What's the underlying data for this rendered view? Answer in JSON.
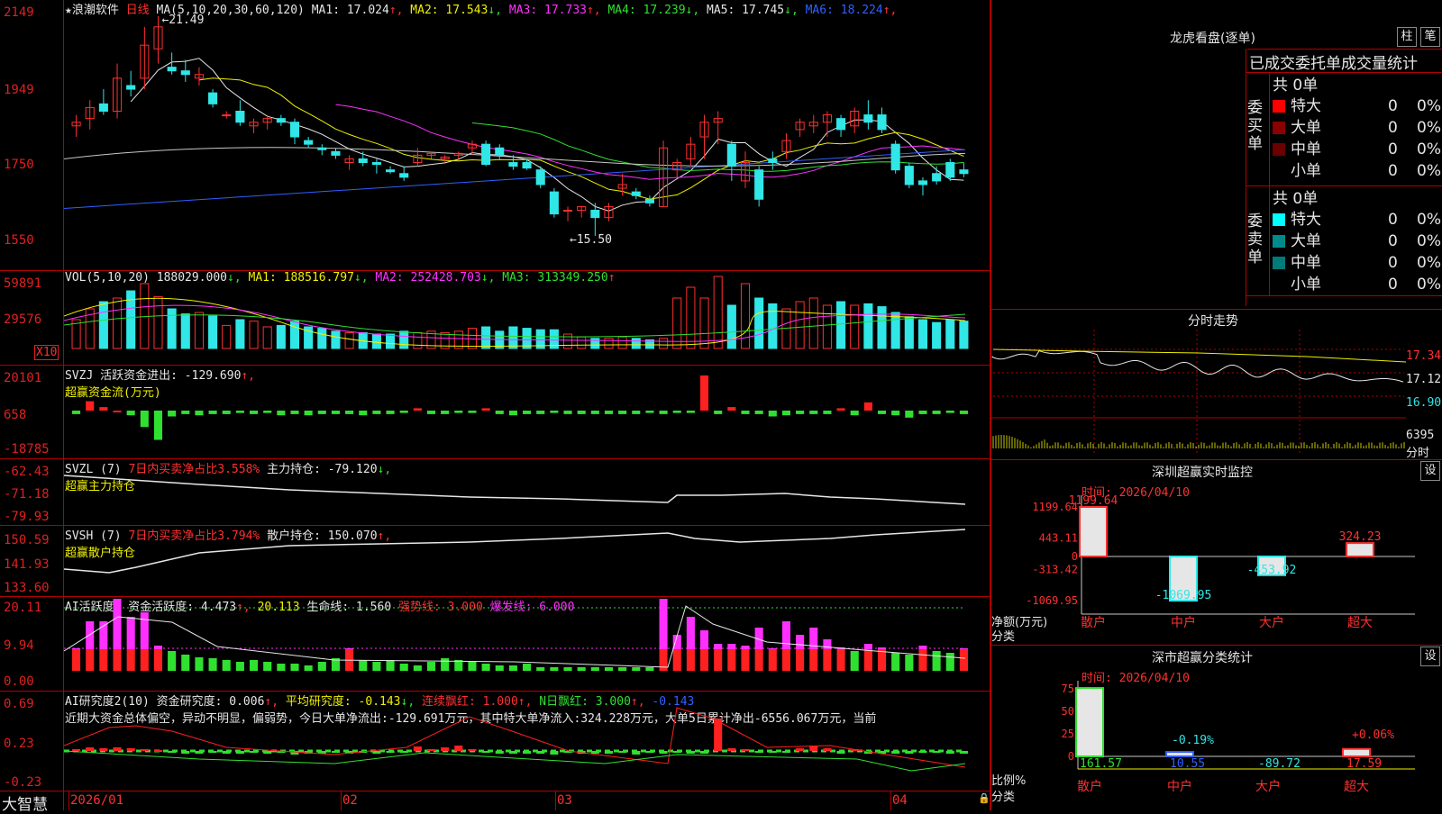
{
  "app": {
    "name": "浪潮软件",
    "period": "日线",
    "brand": "大智慧"
  },
  "main_chart": {
    "ma_params": "MA(5,10,20,30,60,120)",
    "ma": [
      {
        "label": "MA1: 17.024",
        "arrow": "↑",
        "color": "#e6e6e6"
      },
      {
        "label": "MA2: 17.543",
        "arrow": "↓",
        "color": "#f0f000"
      },
      {
        "label": "MA3: 17.733",
        "arrow": "↑",
        "color": "#ff30ff"
      },
      {
        "label": "MA4: 17.239",
        "arrow": "↓",
        "color": "#30e030"
      },
      {
        "label": "MA5: 17.745",
        "arrow": "↓",
        "color": "#e6e6e6"
      },
      {
        "label": "MA6: 18.224",
        "arrow": "↑",
        "color": "#3060ff"
      }
    ],
    "y_ticks": [
      "2149",
      "1949",
      "1750",
      "1550"
    ],
    "high_mark": "21.49",
    "low_mark": "15.50"
  },
  "vol": {
    "legend": "VOL(5,10,20) 188029.000",
    "ma1": "MA1: 188516.797",
    "ma2": "MA2: 252428.703",
    "ma3": "MA3: 313349.250",
    "y_ticks": [
      "59891",
      "29576"
    ],
    "unit": "X10"
  },
  "svzj": {
    "legend": "SVZJ  活跃资金进出: -129.690",
    "sub": "超赢资金流(万元)",
    "y_ticks": [
      "20101",
      "658",
      "-18785"
    ]
  },
  "svzl": {
    "legend": "SVZL (7)",
    "pct": "7日内买卖净占比3.558%",
    "hold": "主力持仓: -79.120",
    "sub": "超赢主力持仓",
    "y_ticks": [
      "-62.43",
      "-71.18",
      "-79.93"
    ]
  },
  "svsh": {
    "legend": "SVSH (7)",
    "pct": "7日内买卖净占比3.794%",
    "hold": "散户持仓: 150.070",
    "sub": "超赢散户持仓",
    "y_ticks": [
      "150.59",
      "141.93",
      "133.60"
    ]
  },
  "ai1": {
    "legend": "AI活跃度2 资金活跃度: 4.473",
    "v2": "20.113",
    "v3": "生命线: 1.560",
    "v4": "强势线: 3.000",
    "v5": "爆发线: 6.000",
    "y_ticks": [
      "20.11",
      "9.94",
      "0.00"
    ]
  },
  "ai2": {
    "legend": "AI研究度2(10) 资金研究度: 0.006",
    "v2": "平均研究度: -0.143",
    "v3": "连续飘红: 1.000",
    "v4": "N日飘红: 3.000",
    "v5": "-0.143",
    "comment": "近期大资金总体偏空，异动不明显，偏弱势，今日大单净流出:-129.691万元，其中特大单净流入:324.228万元，大单5日累计净出-6556.067万元，当前",
    "y_ticks": [
      "0.69",
      "0.23",
      "-0.23"
    ]
  },
  "x_axis": [
    "2026/01",
    "02",
    "03",
    "04"
  ],
  "right": {
    "lhb_title": "龙虎看盘(逐单)",
    "btn1": "柱",
    "btn2": "笔",
    "table_title": "已成交委托单成交量统计",
    "buy_side": "委买单",
    "sell_side": "委卖单",
    "buy_total": "共 0单",
    "sell_total": "共 0单",
    "buy_rows": [
      {
        "name": "特大",
        "n": "0",
        "p": "0%",
        "color": "#ff0000"
      },
      {
        "name": "大单",
        "n": "0",
        "p": "0%",
        "color": "#8b0000"
      },
      {
        "name": "中单",
        "n": "0",
        "p": "0%",
        "color": "#6b0000"
      },
      {
        "name": "小单",
        "n": "0",
        "p": "0%",
        "color": "#000000"
      }
    ],
    "sell_rows": [
      {
        "name": "特大",
        "n": "0",
        "p": "0%",
        "color": "#00ffff"
      },
      {
        "name": "大单",
        "n": "0",
        "p": "0%",
        "color": "#008b8b"
      },
      {
        "name": "中单",
        "n": "0",
        "p": "0%",
        "color": "#007a7a"
      },
      {
        "name": "小单",
        "n": "0",
        "p": "0%",
        "color": "#000000"
      }
    ],
    "fenshi_title": "分时走势",
    "fenshi_ticks": [
      "17.34",
      "17.12",
      "16.90"
    ],
    "fenshi_vol": "6395",
    "fenshi_lbl": "分时",
    "monitor_title": "深圳超赢实时监控",
    "set": "设",
    "monitor_time": "时间: 2026/04/10",
    "monitor_ticks": [
      "1199.64",
      "443.11",
      "0",
      "-313.42",
      "-1069.95"
    ],
    "monitor_values": [
      "1199.64",
      "-1069.95",
      "-453.92",
      "324.23"
    ],
    "monitor_ylabel": "净额(万元)",
    "monitor_xlabel": "分类",
    "cats": [
      "散户",
      "中户",
      "大户",
      "超大"
    ],
    "stat_title": "深市超赢分类统计",
    "stat_time": "时间: 2026/04/10",
    "stat_ticks": [
      "75",
      "50",
      "25",
      "0"
    ],
    "stat_pct": [
      "-0.19%",
      "+0.06%"
    ],
    "stat_values": [
      "161.57",
      "10.55",
      "-89.72",
      "17.59"
    ],
    "stat_ylabel": "比例%",
    "stat_xlabel": "分类"
  },
  "chart_data": {
    "type": "candlestick",
    "ohlc": [
      [
        18.5,
        18.8,
        18.2,
        18.6
      ],
      [
        18.7,
        19.2,
        18.4,
        19.0
      ],
      [
        19.1,
        19.5,
        18.8,
        18.9
      ],
      [
        18.9,
        20.2,
        18.7,
        19.8
      ],
      [
        19.6,
        20.0,
        19.3,
        19.5
      ],
      [
        19.8,
        21.2,
        19.5,
        20.7
      ],
      [
        20.6,
        21.49,
        20.2,
        21.2
      ],
      [
        20.1,
        20.5,
        19.9,
        20.0
      ],
      [
        20.0,
        20.3,
        19.7,
        19.9
      ],
      [
        19.8,
        20.1,
        19.6,
        19.9
      ],
      [
        19.4,
        19.5,
        19.0,
        19.1
      ],
      [
        18.8,
        18.9,
        18.7,
        18.8
      ],
      [
        18.9,
        19.2,
        18.5,
        18.6
      ],
      [
        18.5,
        18.7,
        18.3,
        18.6
      ],
      [
        18.6,
        18.8,
        18.4,
        18.7
      ],
      [
        18.7,
        18.8,
        18.5,
        18.6
      ],
      [
        18.6,
        18.7,
        18.0,
        18.2
      ],
      [
        18.1,
        18.2,
        17.9,
        18.0
      ],
      [
        17.9,
        18.0,
        17.7,
        17.85
      ],
      [
        17.8,
        17.9,
        17.6,
        17.7
      ],
      [
        17.5,
        17.7,
        17.3,
        17.6
      ],
      [
        17.6,
        17.8,
        17.4,
        17.5
      ],
      [
        17.5,
        17.6,
        17.2,
        17.45
      ],
      [
        17.3,
        17.4,
        17.2,
        17.25
      ],
      [
        17.2,
        17.4,
        17.0,
        17.1
      ],
      [
        17.5,
        17.9,
        17.4,
        17.7
      ],
      [
        17.7,
        17.8,
        17.6,
        17.75
      ],
      [
        17.6,
        17.7,
        17.5,
        17.65
      ],
      [
        17.7,
        17.8,
        17.6,
        17.75
      ],
      [
        17.9,
        18.1,
        17.7,
        18.0
      ],
      [
        18.0,
        18.1,
        17.4,
        17.45
      ],
      [
        17.9,
        18.0,
        17.6,
        17.7
      ],
      [
        17.5,
        17.7,
        17.3,
        17.4
      ],
      [
        17.5,
        17.6,
        17.3,
        17.35
      ],
      [
        17.3,
        17.4,
        16.8,
        16.9
      ],
      [
        16.7,
        16.8,
        16.0,
        16.1
      ],
      [
        16.2,
        16.3,
        15.9,
        16.2
      ],
      [
        16.2,
        16.3,
        16.0,
        16.3
      ],
      [
        16.2,
        16.4,
        15.5,
        16.0
      ],
      [
        16.0,
        16.4,
        15.9,
        16.3
      ],
      [
        16.8,
        17.2,
        16.6,
        16.9
      ],
      [
        16.7,
        16.8,
        16.5,
        16.6
      ],
      [
        16.5,
        16.6,
        16.3,
        16.4
      ],
      [
        16.3,
        18.1,
        16.3,
        17.9
      ],
      [
        17.3,
        17.6,
        17.1,
        17.5
      ],
      [
        17.6,
        18.2,
        17.4,
        18.0
      ],
      [
        18.2,
        18.8,
        17.6,
        18.6
      ],
      [
        18.6,
        18.9,
        18.0,
        18.7
      ],
      [
        18.0,
        18.1,
        17.0,
        17.4
      ],
      [
        17.0,
        17.8,
        16.8,
        17.5
      ],
      [
        17.3,
        17.4,
        16.3,
        16.5
      ],
      [
        17.6,
        17.8,
        17.3,
        17.5
      ],
      [
        17.8,
        18.3,
        17.6,
        18.1
      ],
      [
        18.4,
        18.7,
        18.2,
        18.6
      ],
      [
        18.5,
        18.8,
        18.3,
        18.6
      ],
      [
        18.6,
        18.9,
        18.2,
        18.8
      ],
      [
        18.7,
        18.8,
        18.2,
        18.4
      ],
      [
        18.5,
        19.0,
        18.3,
        18.9
      ],
      [
        18.8,
        19.2,
        18.4,
        18.6
      ],
      [
        18.8,
        19.0,
        18.3,
        18.4
      ],
      [
        18.0,
        18.1,
        17.2,
        17.3
      ],
      [
        17.4,
        17.5,
        16.8,
        16.9
      ],
      [
        17.0,
        17.1,
        16.6,
        16.9
      ],
      [
        17.2,
        17.4,
        16.9,
        17.0
      ],
      [
        17.5,
        17.6,
        17.0,
        17.1
      ],
      [
        17.3,
        17.5,
        17.1,
        17.2
      ]
    ],
    "ylim": [
      15.5,
      21.49
    ]
  }
}
